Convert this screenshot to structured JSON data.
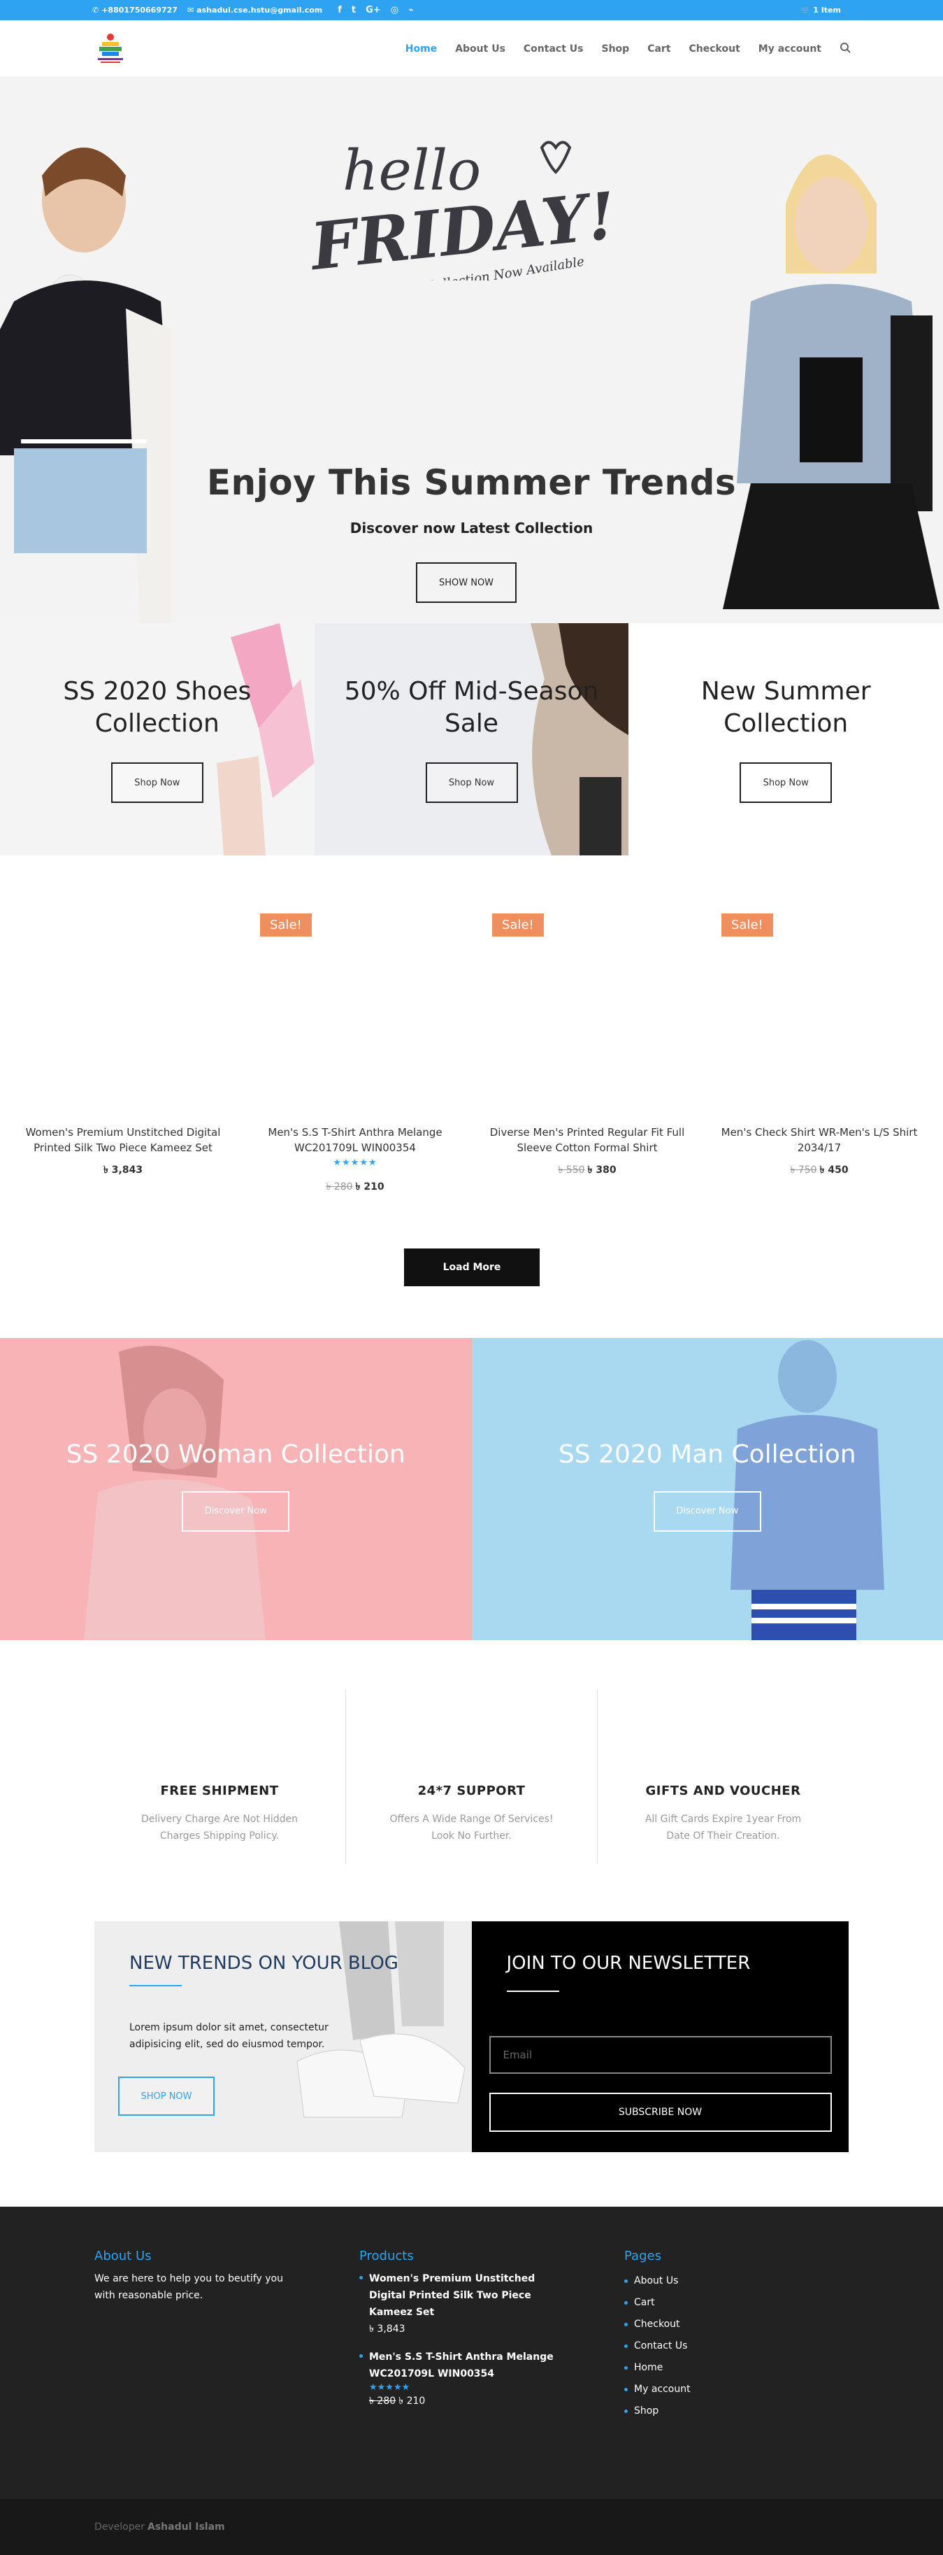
{
  "topbar": {
    "phone": "+8801750669727",
    "email": "ashadul.cse.hstu@gmail.com",
    "social": [
      "facebook-icon",
      "twitter-icon",
      "google-plus-icon",
      "instagram-icon",
      "rss-icon"
    ],
    "cart": "1 Item"
  },
  "nav": {
    "items": [
      "Home",
      "About Us",
      "Contact Us",
      "Shop",
      "Cart",
      "Checkout",
      "My account"
    ]
  },
  "hero": {
    "hello": "hello",
    "friday": "FRIDAY!",
    "tagline": "Casual Collection Now Available",
    "title": "Enjoy This Summer Trends",
    "subtitle": "Discover now Latest Collection",
    "button": "SHOW NOW"
  },
  "promos": [
    {
      "title_line1": "SS 2020 Shoes",
      "title_line2": "Collection",
      "button": "Shop Now"
    },
    {
      "title_line1": "50% Off Mid-Season",
      "title_line2": "Sale",
      "button": "Shop Now"
    },
    {
      "title_line1": "New Summer",
      "title_line2": "Collection",
      "button": "Shop Now"
    }
  ],
  "products": [
    {
      "name": "Women's Premium Unstitched Digital Printed Silk Two Piece Kameez Set",
      "price": "৳ 3,843",
      "old_price": "",
      "sale": "",
      "rating": ""
    },
    {
      "name": "Men's S.S T-Shirt Anthra Melange WC201709L WIN00354",
      "price": "৳ 210",
      "old_price": "৳ 280",
      "sale": "Sale!",
      "rating": "★★★★★"
    },
    {
      "name": "Diverse Men's Printed Regular Fit Full Sleeve Cotton Formal Shirt",
      "price": "৳ 380",
      "old_price": "৳ 550",
      "sale": "Sale!",
      "rating": ""
    },
    {
      "name": "Men's Check Shirt WR-Men's L/S Shirt 2034/17",
      "price": "৳ 450",
      "old_price": "৳ 750",
      "sale": "Sale!",
      "rating": ""
    }
  ],
  "load_more": "Load More",
  "collections": [
    {
      "title": "SS 2020 Woman Collection",
      "button": "Discover Now",
      "color": "#f7b3b6"
    },
    {
      "title": "SS 2020 Man Collection",
      "button": "Discover Now",
      "color": "#a9d9f0"
    }
  ],
  "features": [
    {
      "title": "FREE SHIPMENT",
      "text": "Delivery Charge Are Not Hidden Charges Shipping Policy."
    },
    {
      "title": "24*7 SUPPORT",
      "text": "Offers A Wide Range Of Services! Look No Further."
    },
    {
      "title": "GIFTS AND VOUCHER",
      "text": "All Gift Cards Expire 1year From Date Of Their Creation."
    }
  ],
  "blog": {
    "title": "NEW TRENDS ON YOUR BLOG",
    "text": "Lorem ipsum dolor sit amet, consectetur adipisicing elit, sed do eiusmod tempor.",
    "button": "SHOP NOW"
  },
  "newsletter": {
    "title": "JOIN TO OUR NEWSLETTER",
    "placeholder": "Email",
    "button": "SUBSCRIBE NOW"
  },
  "footer": {
    "about_title": "About Us",
    "about_text": "We are here to help you to beutify you with reasonable price.",
    "products_title": "Products",
    "products": [
      {
        "name": "Women's Premium Unstitched Digital Printed Silk Two Piece Kameez Set",
        "price": "৳ 3,843",
        "old_price": "",
        "rating": ""
      },
      {
        "name": "Men's S.S T-Shirt Anthra Melange WC201709L WIN00354",
        "price": "৳ 210",
        "old_price": "৳ 280",
        "rating": "★★★★★"
      }
    ],
    "pages_title": "Pages",
    "pages": [
      "About Us",
      "Cart",
      "Checkout",
      "Contact Us",
      "Home",
      "My account",
      "Shop"
    ]
  },
  "bottombar": {
    "prefix": "Developer",
    "name": "Ashadul Islam"
  },
  "colors": {
    "accent": "#2ea3f2",
    "sale": "#ef8f5f",
    "footer": "#222222"
  }
}
